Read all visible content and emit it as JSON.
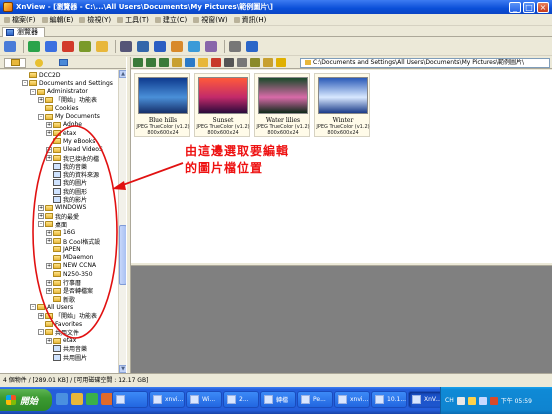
{
  "window": {
    "title": "XnView - [瀏覽器 - C:\\...\\All Users\\Documents\\My Pictures\\範例圖片\\]",
    "controls": [
      "_",
      "□",
      "×"
    ]
  },
  "menu": [
    "檔案(F)",
    "編輯(E)",
    "檢視(Y)",
    "工具(T)",
    "建立(C)",
    "視窗(W)",
    "資訊(H)"
  ],
  "tab": {
    "label": "瀏覽器"
  },
  "toolbar": {
    "icons": [
      "browser-icon",
      "refresh-icon",
      "fullscreen-icon",
      "stop-icon",
      "filter-icon",
      "open-icon",
      "print-icon",
      "scanner-icon",
      "save-icon",
      "slideshow-icon",
      "capture-icon",
      "convert-icon",
      "settings-icon",
      "help-icon"
    ],
    "colors": [
      "#4a7cd8",
      "#2aa34a",
      "#3b6fe0",
      "#d23a2a",
      "#7a9a2a",
      "#e8b73a",
      "#555577",
      "#3366aa",
      "#2b5ec2",
      "#d8892a",
      "#3a9ad8",
      "#8866aa",
      "#777777",
      "#2a66c8"
    ]
  },
  "left_tabs": [
    "folders-icon",
    "favorites-icon",
    "categories-icon"
  ],
  "tree": [
    {
      "label": "DCC2D",
      "indent": 2,
      "expander": "",
      "icon": "folder"
    },
    {
      "label": "Documents and Settings",
      "indent": 2,
      "expander": "-",
      "icon": "folder"
    },
    {
      "label": "Administrator",
      "indent": 3,
      "expander": "-",
      "icon": "folder"
    },
    {
      "label": "「開始」功能表",
      "indent": 4,
      "expander": "+",
      "icon": "folder"
    },
    {
      "label": "Cookies",
      "indent": 4,
      "expander": "",
      "icon": "folder"
    },
    {
      "label": "My Documents",
      "indent": 4,
      "expander": "-",
      "icon": "folder"
    },
    {
      "label": "Adobe",
      "indent": 5,
      "expander": "+",
      "icon": "folder"
    },
    {
      "label": "etax",
      "indent": 5,
      "expander": "+",
      "icon": "folder"
    },
    {
      "label": "My eBooks",
      "indent": 5,
      "expander": "",
      "icon": "folder"
    },
    {
      "label": "Ulead VideoS",
      "indent": 5,
      "expander": "+",
      "icon": "folder"
    },
    {
      "label": "我已接收的檔",
      "indent": 5,
      "expander": "+",
      "icon": "folder"
    },
    {
      "label": "我的音樂",
      "indent": 5,
      "expander": "",
      "icon": "special"
    },
    {
      "label": "我的資料來源",
      "indent": 5,
      "expander": "",
      "icon": "special"
    },
    {
      "label": "我的圖片",
      "indent": 5,
      "expander": "",
      "icon": "special"
    },
    {
      "label": "我的圖形",
      "indent": 5,
      "expander": "",
      "icon": "special"
    },
    {
      "label": "我的影片",
      "indent": 5,
      "expander": "",
      "icon": "special"
    },
    {
      "label": "WINDOWS",
      "indent": 4,
      "expander": "+",
      "icon": "folder"
    },
    {
      "label": "我的最愛",
      "indent": 4,
      "expander": "+",
      "icon": "folder"
    },
    {
      "label": "桌面",
      "indent": 4,
      "expander": "-",
      "icon": "folder"
    },
    {
      "label": "16G",
      "indent": 5,
      "expander": "+",
      "icon": "folder"
    },
    {
      "label": "B Cool格式設",
      "indent": 5,
      "expander": "+",
      "icon": "folder"
    },
    {
      "label": "JAPEN",
      "indent": 5,
      "expander": "",
      "icon": "folder"
    },
    {
      "label": "MDaemon",
      "indent": 5,
      "expander": "",
      "icon": "folder"
    },
    {
      "label": "NEW CCNA",
      "indent": 5,
      "expander": "+",
      "icon": "folder"
    },
    {
      "label": "N250-350",
      "indent": 5,
      "expander": "",
      "icon": "folder"
    },
    {
      "label": "行事曆",
      "indent": 5,
      "expander": "+",
      "icon": "folder"
    },
    {
      "label": "是否轉檔案",
      "indent": 5,
      "expander": "+",
      "icon": "folder"
    },
    {
      "label": "新歌",
      "indent": 5,
      "expander": "",
      "icon": "folder"
    },
    {
      "label": "All Users",
      "indent": 3,
      "expander": "-",
      "icon": "folder"
    },
    {
      "label": "「開始」功能表",
      "indent": 4,
      "expander": "+",
      "icon": "folder"
    },
    {
      "label": "Favorites",
      "indent": 4,
      "expander": "",
      "icon": "folder"
    },
    {
      "label": "共用文件",
      "indent": 4,
      "expander": "-",
      "icon": "folder"
    },
    {
      "label": "etax",
      "indent": 5,
      "expander": "+",
      "icon": "folder"
    },
    {
      "label": "共用音樂",
      "indent": 5,
      "expander": "",
      "icon": "special"
    },
    {
      "label": "共用圖片",
      "indent": 5,
      "expander": "",
      "icon": "special"
    }
  ],
  "right_tools": {
    "icons": [
      "back-icon",
      "forward-icon",
      "up-icon",
      "home-icon",
      "refresh-icon",
      "new-folder-icon",
      "delete-icon",
      "view-mode-icon",
      "sort-icon",
      "filter-icon",
      "tag-icon",
      "star-icon"
    ],
    "colors": [
      "#3a7a3a",
      "#3a7a3a",
      "#3a7a3a",
      "#c8a030",
      "#2a7ac8",
      "#e8b73a",
      "#c83a2a",
      "#555555",
      "#777777",
      "#8a8a2a",
      "#c8a030",
      "#e0b000"
    ]
  },
  "address": {
    "value": "C:\\Documents and Settings\\All Users\\Documents\\My Pictures\\範例圖片\\"
  },
  "thumbnails": [
    {
      "name": "Blue hills",
      "format": "JPEG TrueColor (v1.2)",
      "size": "800x600x24",
      "colors": [
        "#0e3a8e",
        "#4a8fd8",
        "#16306a"
      ]
    },
    {
      "name": "Sunset",
      "format": "JPEG TrueColor (v1.2)",
      "size": "800x600x24",
      "colors": [
        "#ff5a3a",
        "#c22a6a",
        "#2a0a3a"
      ]
    },
    {
      "name": "Water lilies",
      "format": "JPEG TrueColor (v1.2)",
      "size": "800x600x24",
      "colors": [
        "#1a4a2a",
        "#d86aa8",
        "#0e2a1a"
      ]
    },
    {
      "name": "Winter",
      "format": "JPEG TrueColor (v1.2)",
      "size": "800x600x24",
      "colors": [
        "#2a5ab8",
        "#d8e8ff",
        "#1a3a88"
      ]
    }
  ],
  "annotation": {
    "line1": "由這邊選取要編輯",
    "line2": "的圖片檔位置",
    "color": "#e11111"
  },
  "status": {
    "text": "4 個物件 / [289.01 KB] / [可用磁碟空間 : 12.17 GB]"
  },
  "taskbar": {
    "start_label": "開始",
    "quick_launch_colors": [
      "#4a90e0",
      "#e8b73a",
      "#3ab04a",
      "#e06a2a"
    ],
    "tasks": [
      {
        "label": "",
        "active": false
      },
      {
        "label": "xnvi...",
        "active": false
      },
      {
        "label": "Wi...",
        "active": false
      },
      {
        "label": "2...",
        "active": false
      },
      {
        "label": "轉檔",
        "active": false
      },
      {
        "label": "Pe...",
        "active": false
      },
      {
        "label": "xnvi...",
        "active": false
      },
      {
        "label": "10.1...",
        "active": false
      },
      {
        "label": "XnV...",
        "active": true
      }
    ],
    "tray": {
      "lang": "CH",
      "clock": "下午 05:59"
    }
  }
}
